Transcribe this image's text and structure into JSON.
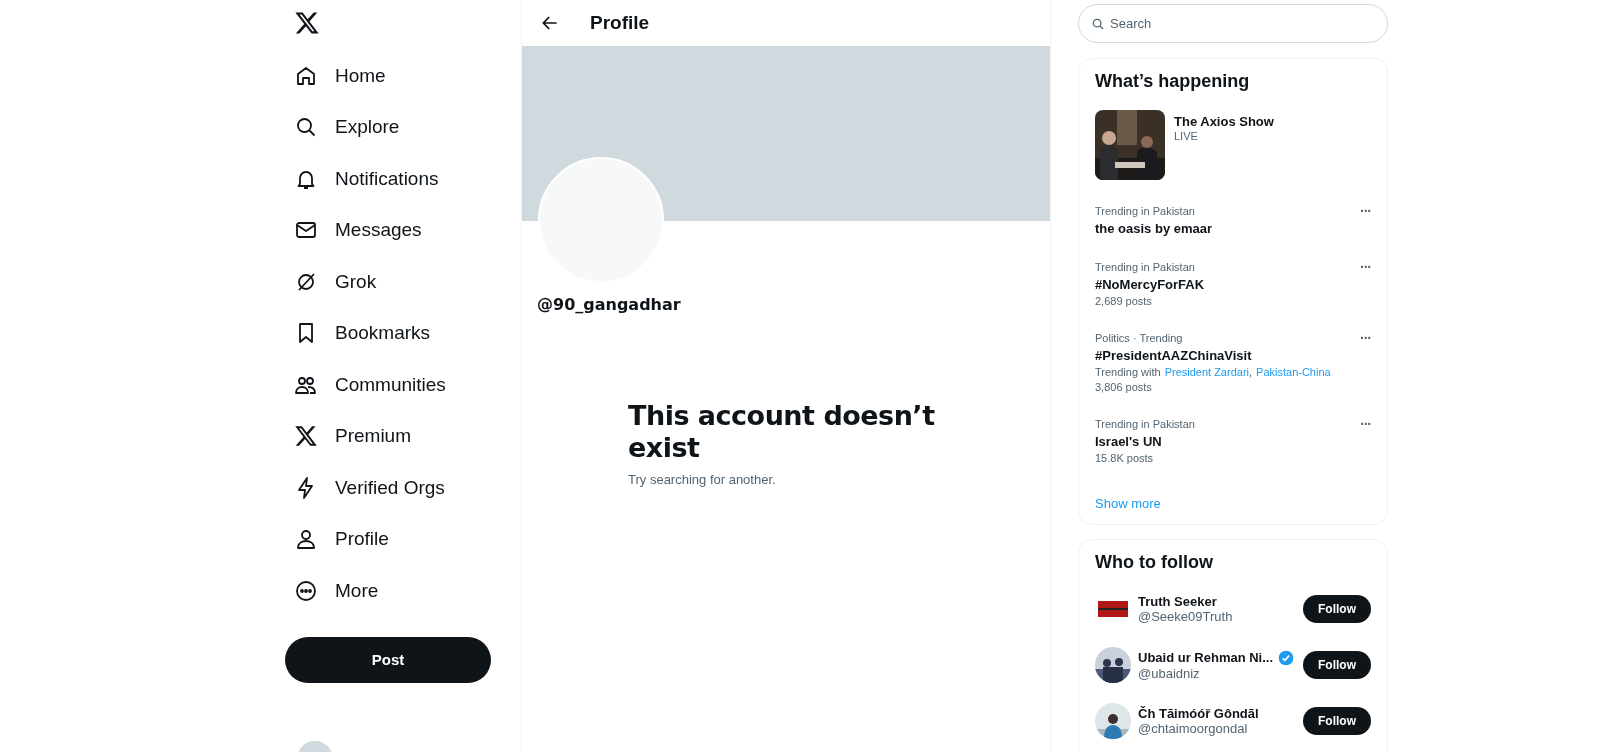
{
  "nav": {
    "items": [
      {
        "label": "Home"
      },
      {
        "label": "Explore"
      },
      {
        "label": "Notifications"
      },
      {
        "label": "Messages"
      },
      {
        "label": "Grok"
      },
      {
        "label": "Bookmarks"
      },
      {
        "label": "Communities"
      },
      {
        "label": "Premium"
      },
      {
        "label": "Verified Orgs"
      },
      {
        "label": "Profile"
      },
      {
        "label": "More"
      }
    ],
    "post_button": "Post"
  },
  "header": {
    "title": "Profile"
  },
  "profile": {
    "handle": "@90_gangadhar",
    "message_title": "This account doesn’t exist",
    "message_body": "Try searching for another."
  },
  "search": {
    "placeholder": "Search"
  },
  "whats_happening": {
    "title": "What’s happening",
    "featured": {
      "title": "The Axios Show",
      "badge": "LIVE"
    },
    "trends": [
      {
        "category": "Trending in Pakistan",
        "title": "the oasis by emaar"
      },
      {
        "category": "Trending in Pakistan",
        "title": "#NoMercyForFAK",
        "posts": "2,689 posts"
      },
      {
        "category": "Politics · Trending",
        "title": "#PresidentAAZChinaVisit",
        "related": [
          {
            "kind": "text",
            "text": "Trending with"
          },
          {
            "kind": "link",
            "text": "President Zardari"
          },
          {
            "kind": "text",
            "text": ","
          },
          {
            "kind": "link",
            "text": "Pakistan-China"
          }
        ],
        "posts": "3,806 posts"
      },
      {
        "category": "Trending in Pakistan",
        "title": "Israel's UN",
        "posts": "15.8K posts"
      }
    ],
    "more_label": "···",
    "show_more": "Show more"
  },
  "who_to_follow": {
    "title": "Who to follow",
    "accounts": [
      {
        "name": "Truth Seeker",
        "handle": "@Seeke09Truth",
        "verified": false,
        "button": "Follow"
      },
      {
        "name": "Ubaid ur Rehman Ni...",
        "handle": "@ubaidniz",
        "verified": true,
        "button": "Follow"
      },
      {
        "name": "Čh Tāimóóř Gôndãl",
        "handle": "@chtaimoorgondal",
        "verified": false,
        "button": "Follow"
      }
    ]
  }
}
